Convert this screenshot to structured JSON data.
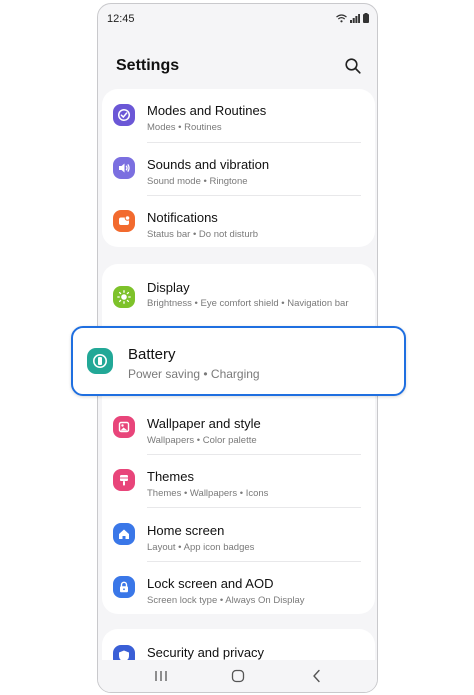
{
  "status_bar": {
    "time": "12:45"
  },
  "header": {
    "title": "Settings"
  },
  "groups": [
    {
      "items": [
        {
          "title": "Modes and Routines",
          "subtitle": "Modes  •  Routines",
          "icon": "modes-routines-icon",
          "color": "#6b57d6"
        },
        {
          "title": "Sounds and vibration",
          "subtitle": "Sound mode  •  Ringtone",
          "icon": "sound-icon",
          "color": "#7b6fe0"
        },
        {
          "title": "Notifications",
          "subtitle": "Status bar  •  Do not disturb",
          "icon": "notification-icon",
          "color": "#f26a2e"
        }
      ]
    },
    {
      "items": [
        {
          "title": "Display",
          "subtitle": "Brightness  •  Eye comfort shield  •  Navigation bar",
          "icon": "display-icon",
          "color": "#7dc22a"
        },
        {
          "title": "Wallpaper and style",
          "subtitle": "Wallpapers  •  Color palette",
          "icon": "wallpaper-icon",
          "color": "#e8457a"
        },
        {
          "title": "Themes",
          "subtitle": "Themes  •  Wallpapers  •  Icons",
          "icon": "themes-icon",
          "color": "#e8457a"
        },
        {
          "title": "Home screen",
          "subtitle": "Layout  •  App icon badges",
          "icon": "home-icon",
          "color": "#3a77e8"
        },
        {
          "title": "Lock screen and AOD",
          "subtitle": "Screen lock type  •  Always On Display",
          "icon": "lock-icon",
          "color": "#3a77e8"
        }
      ]
    },
    {
      "items": [
        {
          "title": "Security and privacy",
          "icon": "security-icon",
          "color": "#3a5fd6"
        }
      ]
    }
  ],
  "highlight": {
    "title": "Battery",
    "subtitle": "Power saving  •  Charging",
    "icon": "battery-icon",
    "color": "#22a897",
    "border_color": "#1f6fe0"
  }
}
